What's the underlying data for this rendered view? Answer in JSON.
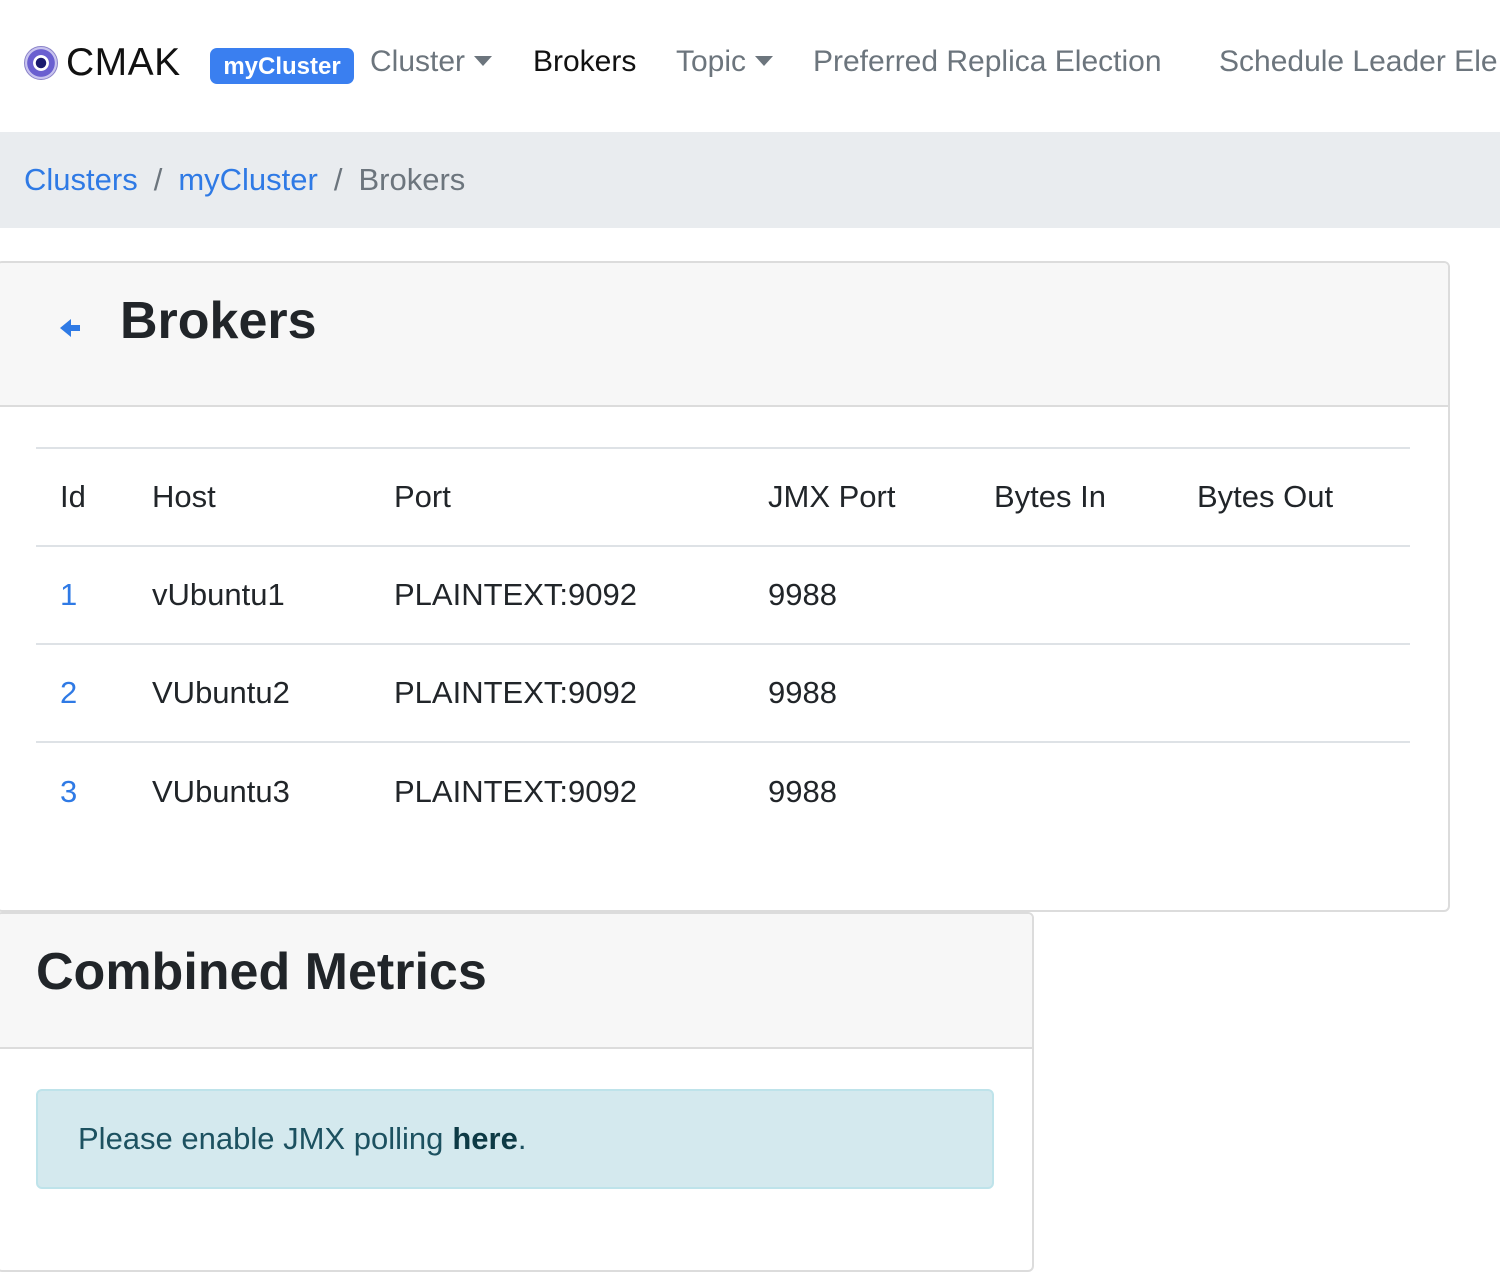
{
  "navbar": {
    "brand": "CMAK",
    "cluster_badge": "myCluster",
    "items": [
      {
        "label": "Cluster",
        "dropdown": true
      },
      {
        "label": "Brokers",
        "active": true
      },
      {
        "label": "Topic",
        "dropdown": true
      },
      {
        "label": "Preferred Replica Election"
      },
      {
        "label": "Schedule Leader Ele"
      }
    ]
  },
  "breadcrumb": {
    "items": [
      "Clusters",
      "myCluster"
    ],
    "separator": "/",
    "current": "Brokers"
  },
  "brokers": {
    "title": "Brokers",
    "columns": [
      "Id",
      "Host",
      "Port",
      "JMX Port",
      "Bytes In",
      "Bytes Out"
    ],
    "rows": [
      {
        "id": "1",
        "host": "vUbuntu1",
        "port": "PLAINTEXT:9092",
        "jmx_port": "9988",
        "bytes_in": "",
        "bytes_out": ""
      },
      {
        "id": "2",
        "host": "VUbuntu2",
        "port": "PLAINTEXT:9092",
        "jmx_port": "9988",
        "bytes_in": "",
        "bytes_out": ""
      },
      {
        "id": "3",
        "host": "VUbuntu3",
        "port": "PLAINTEXT:9092",
        "jmx_port": "9988",
        "bytes_in": "",
        "bytes_out": ""
      }
    ]
  },
  "combined_metrics": {
    "title": "Combined Metrics",
    "alert_text": "Please enable JMX polling",
    "alert_link": "here",
    "alert_suffix": "."
  },
  "colors": {
    "accent": "#2f7ae5",
    "badge": "#3a7ff0",
    "breadcrumb_bg": "#e9ecef",
    "alert_bg": "#d4e9ee"
  },
  "icons": {
    "brand": "cmak-logo-icon",
    "back": "arrow-left-icon",
    "dropdown": "caret-down-icon"
  }
}
